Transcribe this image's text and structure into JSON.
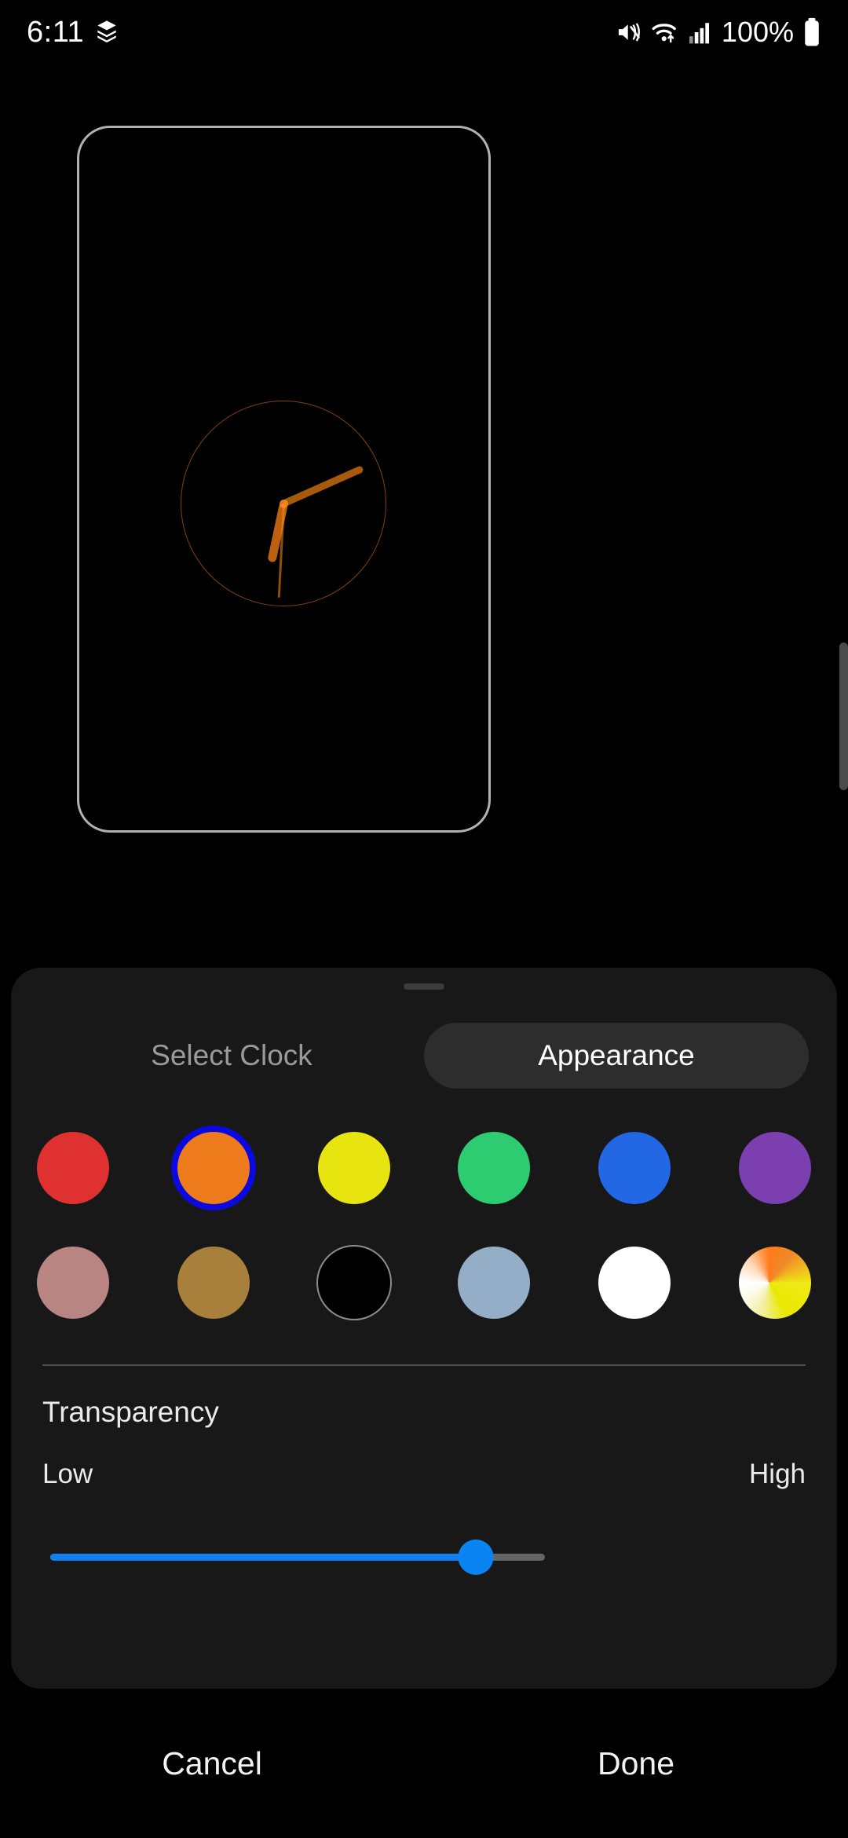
{
  "status_bar": {
    "time": "6:11",
    "left_icons": [
      "layers-icon"
    ],
    "right_icons": [
      "mute-icon",
      "wifi-icon",
      "signal-icon"
    ],
    "battery_percent": "100%"
  },
  "preview": {
    "frame_color": "#aeb2b8",
    "clock": {
      "type": "analog",
      "face_color": "#ff7a18",
      "hour_angle_deg": 192,
      "minute_angle_deg": 66,
      "second_angle_deg": 183
    }
  },
  "scrollbar": {
    "color": "#4b4b4b"
  },
  "sheet": {
    "handle": "drag-handle",
    "tabs": [
      {
        "label": "Select Clock",
        "active": false
      },
      {
        "label": "Appearance",
        "active": true
      }
    ],
    "colors": {
      "selection_ring": "#0a0ae0",
      "rows": [
        [
          {
            "name": "red",
            "hex": "#e03131",
            "selected": false,
            "outlined": false,
            "multi": false
          },
          {
            "name": "orange",
            "hex": "#ef7c1c",
            "selected": true,
            "outlined": false,
            "multi": false
          },
          {
            "name": "yellow",
            "hex": "#e8e40f",
            "selected": false,
            "outlined": false,
            "multi": false
          },
          {
            "name": "green",
            "hex": "#2ecc71",
            "selected": false,
            "outlined": false,
            "multi": false
          },
          {
            "name": "blue",
            "hex": "#2267e3",
            "selected": false,
            "outlined": false,
            "multi": false
          },
          {
            "name": "purple",
            "hex": "#7b3fb0",
            "selected": false,
            "outlined": false,
            "multi": false
          }
        ],
        [
          {
            "name": "rose",
            "hex": "#b98582",
            "selected": false,
            "outlined": false,
            "multi": false
          },
          {
            "name": "bronze",
            "hex": "#a8803c",
            "selected": false,
            "outlined": false,
            "multi": false
          },
          {
            "name": "black",
            "hex": "#000000",
            "selected": false,
            "outlined": true,
            "multi": false
          },
          {
            "name": "steel-blue",
            "hex": "#93aec6",
            "selected": false,
            "outlined": false,
            "multi": false
          },
          {
            "name": "white",
            "hex": "#ffffff",
            "selected": false,
            "outlined": false,
            "multi": false
          },
          {
            "name": "multicolor",
            "hex": "",
            "selected": false,
            "outlined": false,
            "multi": true
          }
        ]
      ]
    },
    "transparency": {
      "label": "Transparency",
      "low_label": "Low",
      "high_label": "High",
      "value_percent": 86,
      "accent": "#127fec"
    }
  },
  "footer": {
    "cancel_label": "Cancel",
    "done_label": "Done"
  }
}
